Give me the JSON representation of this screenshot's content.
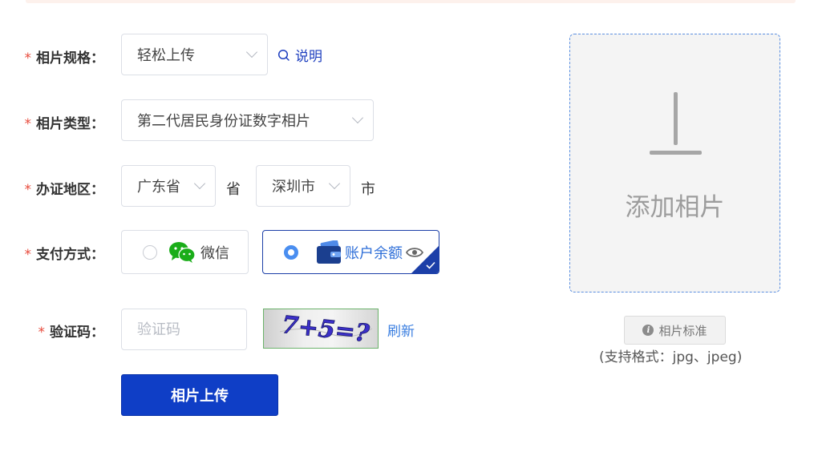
{
  "form": {
    "spec": {
      "label": "相片规格",
      "value": "轻松上传",
      "explain": "说明"
    },
    "type": {
      "label": "相片类型",
      "value": "第二代居民身份证数字相片"
    },
    "region": {
      "label": "办证地区",
      "province": "广东省",
      "province_unit": "省",
      "city": "深圳市",
      "city_unit": "市"
    },
    "payment": {
      "label": "支付方式",
      "options": [
        {
          "label": "微信",
          "selected": false,
          "icon": "wechat-icon"
        },
        {
          "label": "账户余额",
          "selected": true,
          "icon": "wallet-icon"
        }
      ]
    },
    "captcha": {
      "label": "验证码",
      "placeholder": "验证码",
      "image_text": "7+5=?",
      "refresh": "刷新"
    },
    "submit": "相片上传",
    "required_mark": "*",
    "colon": "："
  },
  "upload": {
    "text": "添加相片",
    "standard_button": "相片标准",
    "formats": "(支持格式：jpg、jpeg)"
  },
  "colors": {
    "accent": "#0f3ec6",
    "required": "#e84a3c",
    "link": "#3a7ee0"
  }
}
